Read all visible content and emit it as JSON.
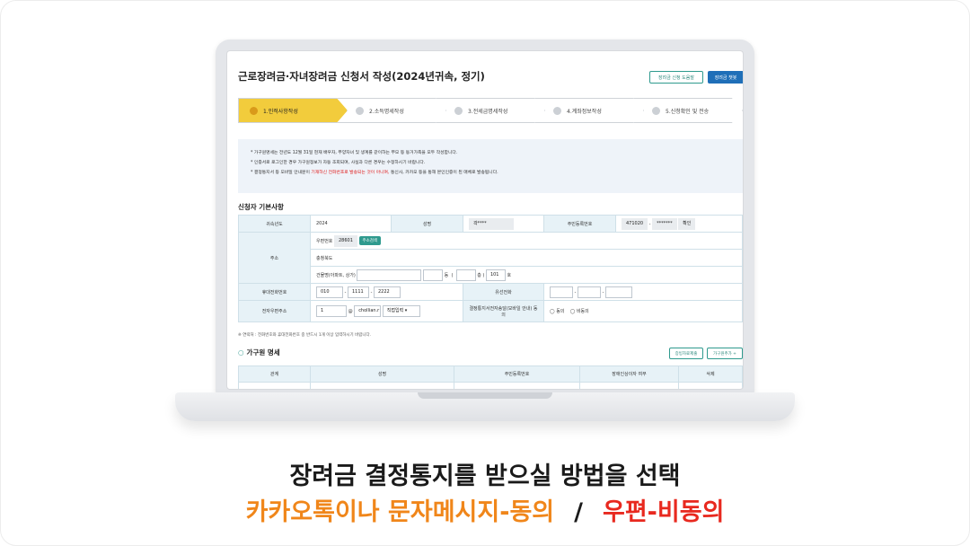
{
  "window": {
    "title": "근로장려금·자녀장려금 신청서 작성(2024년귀속, 정기)"
  },
  "header_buttons": {
    "guide": "장려금 신청 도움말",
    "chatbot": "장려금 챗봇"
  },
  "steps": [
    {
      "num": "",
      "label": "1.인적사항작성"
    },
    {
      "num": "",
      "label": "2.소득명세작성"
    },
    {
      "num": "",
      "label": "3.전세금명세작성"
    },
    {
      "num": "",
      "label": "4.계좌정보작성"
    },
    {
      "num": "",
      "label": "5.신청확인 및 전송"
    }
  ],
  "notice": {
    "line1": "* 가구원명세는 전년도 12월 31일 현재 배우자, 부양자녀 및 생계를 같이하는 부모 등 동거가족을 모두 작성합니다.",
    "line2": "* 인증서로 로그인한 경우 가구원정보가 자동 조회되며, 사실과 다른 경우는 수정하시기 바랍니다.",
    "line3_a": "* 결정통지서 등 모바일 안내문이 ",
    "line3_red": "기재하신 전화번호로 발송되는 것이 아니며,",
    "line3_b": "  통신사, 카카오 등을 통해 본인인증이 된 매체로 발송됩니다."
  },
  "basic": {
    "title": "신청자 기본사항",
    "year_label": "귀속년도",
    "year": "2024",
    "name_label": "성명",
    "name": "곽****",
    "rrn_label": "주민등록번호",
    "rrn_front": "471020",
    "rrn_back": "*******",
    "confirm": "확인",
    "addr_label": "주소",
    "postal_label": "우편번호",
    "postal": "28601",
    "addr_search": "주소검색",
    "addr_line": "충청북도",
    "building_label": "건물명(아파트, 상가)",
    "dong": "동",
    "floor": "층",
    "ho_value": "101",
    "ho": "호",
    "mobile_label": "휴대전화번호",
    "mobile1": "010",
    "mobile2": "1111",
    "mobile3": "2222",
    "tel_label": "유선전화",
    "email_label": "전자우편주소",
    "email_id": "1",
    "at": "@",
    "email_domain": "chollian.r",
    "email_select": "직접입력",
    "consent_label": "결정통지서전자송달(모바일 안내) 동의",
    "consent_yes": "동의",
    "consent_no": "비동의"
  },
  "note": "※ 연락처 : 전화번호와 휴대전화번호 중 반드시 1개 이상 입력하시기 바랍니다.",
  "members": {
    "title": "가구원 명세",
    "btn_docs": "증빙자료제출",
    "btn_add": "가구원추가 +",
    "columns": [
      "관계",
      "성명",
      "주민등록번호",
      "장애인상이자 여부",
      "삭제"
    ]
  },
  "captions": {
    "line1": "장려금 결정통지를 받으실 방법을 선택",
    "orange": "카카오톡이나 문자메시지-동의",
    "sep": "/",
    "red": "우편-비동의"
  }
}
